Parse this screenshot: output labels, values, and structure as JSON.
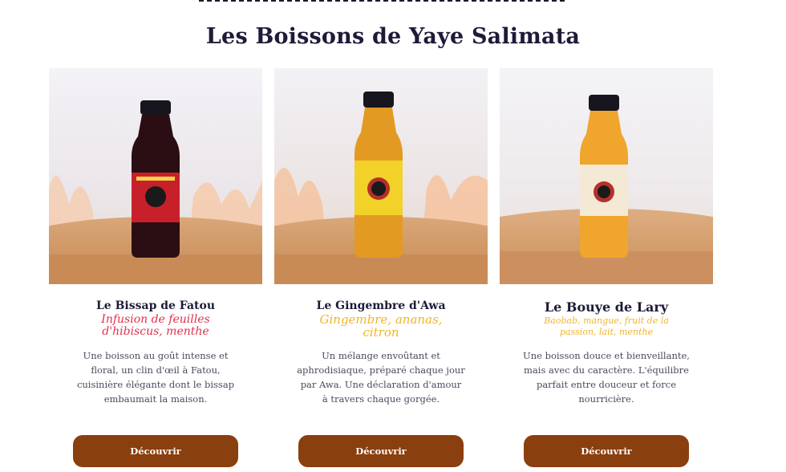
{
  "section": {
    "title": "Les Boissons de Yaye Salimata"
  },
  "products": [
    {
      "name": "Le Bissap de Fatou",
      "subtitle": "Infusion de feuilles d'hibiscus, menthe",
      "subtitle_color": "#e0304a",
      "description": "Une boisson au goût intense et floral, un clin d'œil à Fatou, cuisinière élégante dont le bissap embaumait la maison.",
      "button_label": "Découvrir",
      "liquid_color": "#2a0e14"
    },
    {
      "name": "Le Gingembre d'Awa",
      "subtitle": "Gingembre, ananas, citron",
      "subtitle_color": "#f0b429",
      "description": "Un mélange envoûtant et aphrodisiaque, préparé chaque jour par Awa. Une déclaration d'amour à travers chaque gorgée.",
      "button_label": "Découvrir",
      "liquid_color": "#e39a22"
    },
    {
      "name": "Le Bouye de Lary",
      "subtitle": "Baobab, mangue, fruit de la passion, lait, menthe",
      "subtitle_color": "#f0b429",
      "description": "Une boisson douce et bienveillante, mais avec du caractère. L'équilibre parfait entre douceur et force nourricière.",
      "button_label": "Découvrir",
      "liquid_color": "#f0a52c"
    }
  ],
  "brand_colors": {
    "button": "#8a3f0f",
    "title": "#1d1b38"
  }
}
